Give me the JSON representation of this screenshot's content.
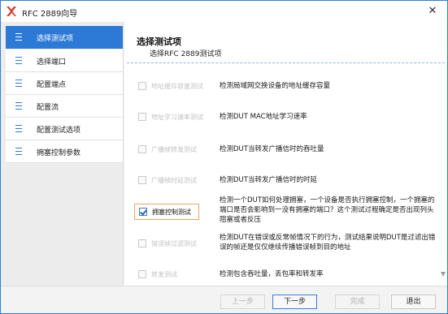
{
  "window": {
    "title": "RFC 2889向导",
    "close_glyph": "✕",
    "accent_color": "#2d7ad6"
  },
  "sidebar": {
    "items": [
      {
        "label": "选择测试项",
        "active": true
      },
      {
        "label": "选择端口",
        "active": false
      },
      {
        "label": "配置端点",
        "active": false
      },
      {
        "label": "配置流",
        "active": false
      },
      {
        "label": "配置测试选项",
        "active": false
      },
      {
        "label": "拥塞控制参数",
        "active": false
      }
    ]
  },
  "main": {
    "title": "选择测试项",
    "subtitle": "选择RFC 2889测试项",
    "tests": [
      {
        "name": "地址缓存容量测试",
        "checked": false,
        "enabled": false,
        "description": [
          "检测局域网交换设备的地址缓存容量"
        ]
      },
      {
        "name": "地址学习速率测试",
        "checked": false,
        "enabled": false,
        "description": [
          "检测DUT MAC地址学习速率"
        ]
      },
      {
        "name": "广播帧转发测试",
        "checked": false,
        "enabled": false,
        "description": [
          "检测DUT当转发广播信时的吞吐量"
        ]
      },
      {
        "name": "广播帧时延测试",
        "checked": false,
        "enabled": false,
        "description": [
          "检测DUT当转发广播信时的时延"
        ]
      },
      {
        "name": "拥塞控制测试",
        "checked": true,
        "enabled": true,
        "description": [
          "检测一个DUT如何处理拥塞，一个设备是否执行拥塞控制，一个拥塞的",
          "端口是否会影响到一没有拥塞的端口？这个测试过程确定是否出现列头",
          "阻塞或者反压"
        ]
      },
      {
        "name": "错误帧过滤测试",
        "checked": false,
        "enabled": false,
        "description": [
          "检测DUT在错误或反常帧情况下的行为，测试结果说明DUT是过滤出错",
          "误的帧还是仅仅继续传播错误帧到目的地址"
        ]
      },
      {
        "name": "转发测试",
        "checked": false,
        "enabled": false,
        "description": [
          "检测包含吞吐量，丢包率和转发率"
        ]
      }
    ]
  },
  "footer": {
    "prev_label": "上一步",
    "next_label": "下一步",
    "finish_label": "完成",
    "exit_label": "退出"
  }
}
